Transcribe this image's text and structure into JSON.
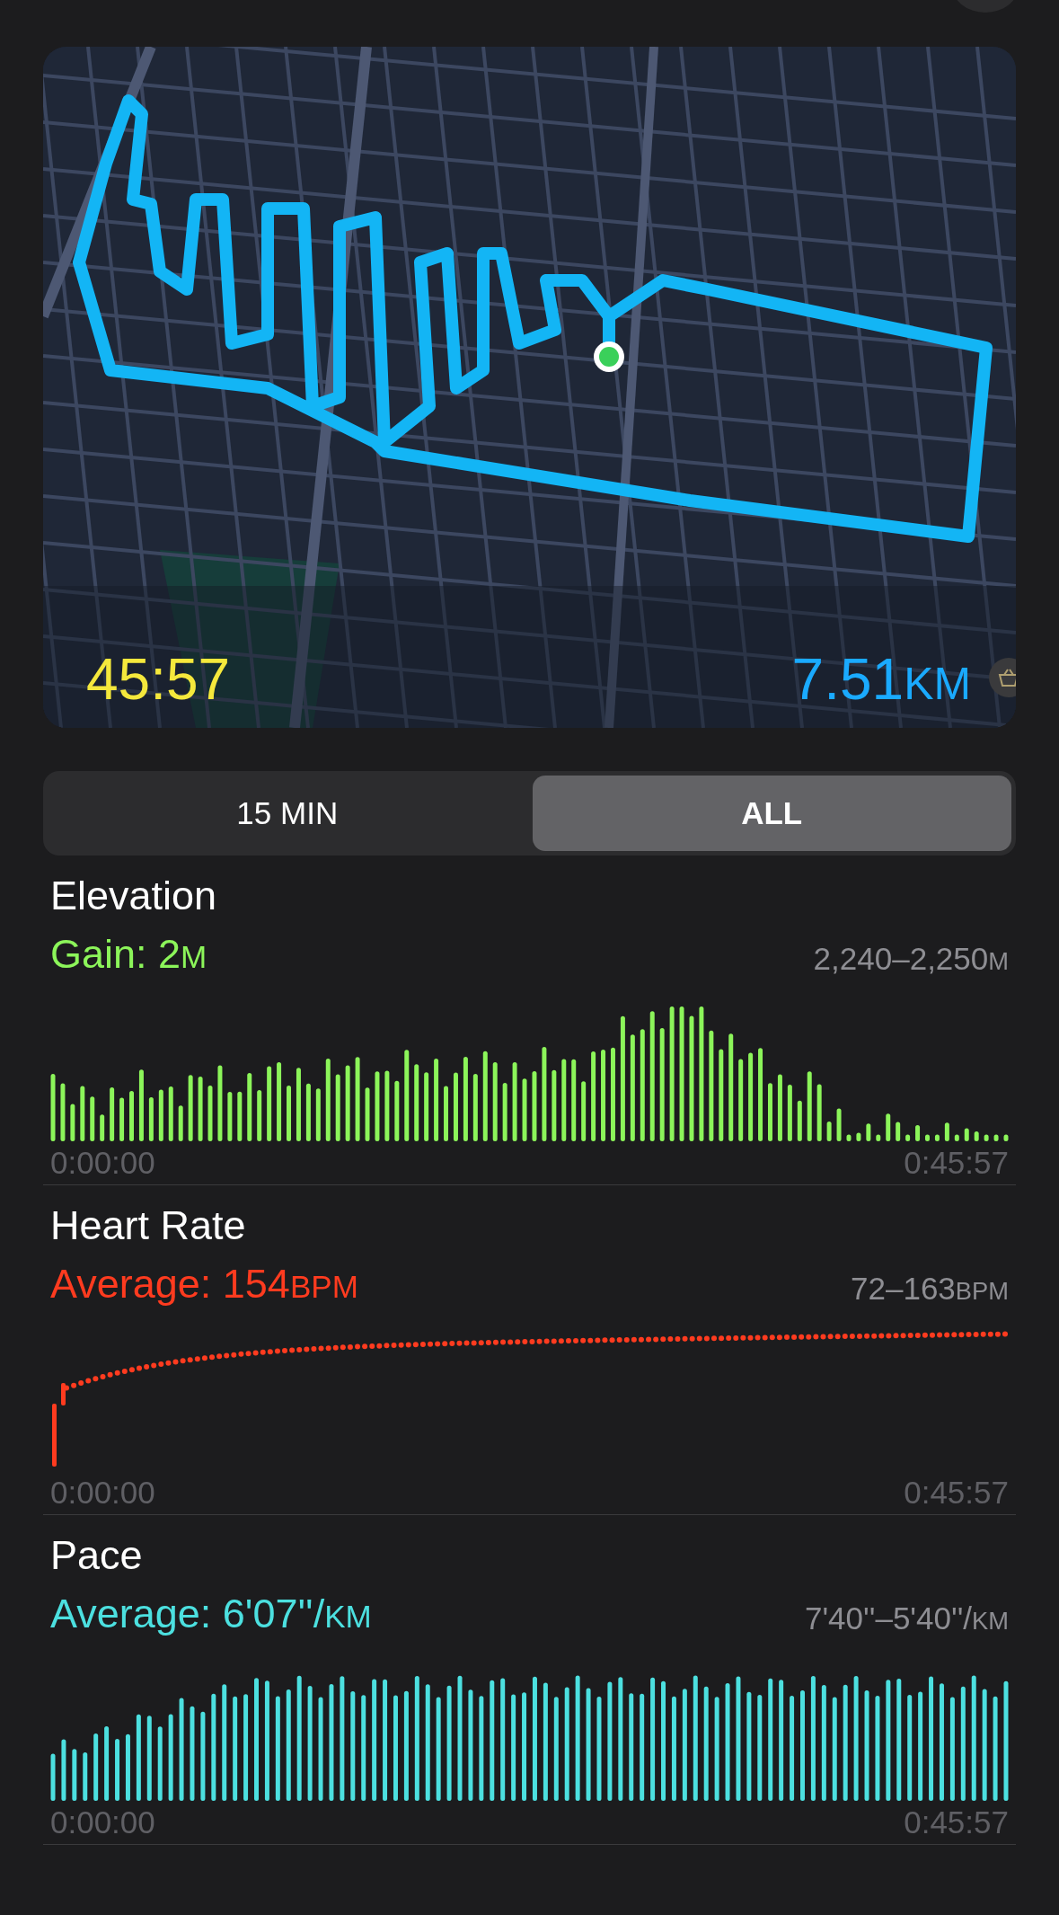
{
  "map": {
    "duration": "45:57",
    "distance": "7.51",
    "distance_unit": "KM"
  },
  "segments": [
    {
      "label": "15 MIN",
      "selected": false
    },
    {
      "label": "ALL",
      "selected": true
    }
  ],
  "metrics": [
    {
      "kind": "bars",
      "title": "Elevation",
      "summary_label": "Gain:",
      "summary_value": "2",
      "summary_unit": "M",
      "range": "2,240–2,250",
      "range_unit": "M",
      "start": "0:00:00",
      "end": "0:45:57",
      "color": "#8cf55a"
    },
    {
      "kind": "dots",
      "title": "Heart Rate",
      "summary_label": "Average:",
      "summary_value": "154",
      "summary_unit": "BPM",
      "range": "72–163",
      "range_unit": "BPM",
      "start": "0:00:00",
      "end": "0:45:57",
      "color": "#ff3b1f"
    },
    {
      "kind": "bars",
      "title": "Pace",
      "summary_label": "Average:",
      "summary_value": "6'07''/",
      "summary_unit": "KM",
      "range": "7'40''–5'40''/",
      "range_unit": "KM",
      "start": "0:00:00",
      "end": "0:45:57",
      "color": "#4ce0e0"
    }
  ]
}
